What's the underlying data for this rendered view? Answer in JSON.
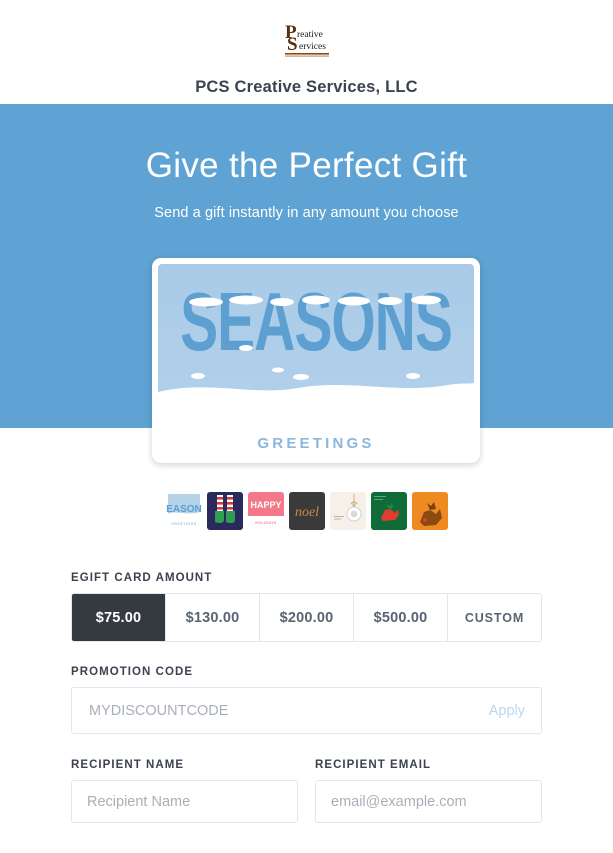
{
  "header": {
    "logo_alt": "PCS Creative Services logo",
    "logo_line1": "reative",
    "logo_line2": "ervices",
    "logo_mark": "PCS",
    "title": "PCS Creative Services, LLC"
  },
  "hero": {
    "title": "Give the Perfect Gift",
    "subtitle": "Send a gift instantly in any amount you choose",
    "background_color": "#5ea3d3",
    "prev_label": "Previous design",
    "next_label": "Next design"
  },
  "carousel": {
    "card": {
      "headline": "SEASONS",
      "caption": "GREETINGS",
      "art_color": "#5c9fd0",
      "sky_color": "#a9cbe8"
    },
    "thumbnails": [
      {
        "name": "seasons-greetings",
        "label": "SEASONS GREETINGS",
        "selected": true
      },
      {
        "name": "elf-boots",
        "label": "Elf Boots",
        "selected": false
      },
      {
        "name": "happy-holidays",
        "label": "HAPPY HOLIDAYS",
        "selected": false
      },
      {
        "name": "noel-script",
        "label": "noel",
        "selected": false
      },
      {
        "name": "ornament",
        "label": "Ornament",
        "selected": false
      },
      {
        "name": "green-reindeer",
        "label": "Green Reindeer",
        "selected": false
      },
      {
        "name": "orange-reindeer",
        "label": "Orange Reindeer",
        "selected": false
      }
    ]
  },
  "form": {
    "amount": {
      "label": "EGIFT CARD AMOUNT",
      "options": [
        "$75.00",
        "$130.00",
        "$200.00",
        "$500.00",
        "CUSTOM"
      ],
      "selected_index": 0,
      "selected_value": "$75.00"
    },
    "promotion": {
      "label": "PROMOTION CODE",
      "placeholder": "MYDISCOUNTCODE",
      "value": "",
      "apply_label": "Apply"
    },
    "recipient_name": {
      "label": "RECIPIENT NAME",
      "placeholder": "Recipient Name",
      "value": ""
    },
    "recipient_email": {
      "label": "RECIPIENT EMAIL",
      "placeholder": "email@example.com",
      "value": ""
    }
  }
}
